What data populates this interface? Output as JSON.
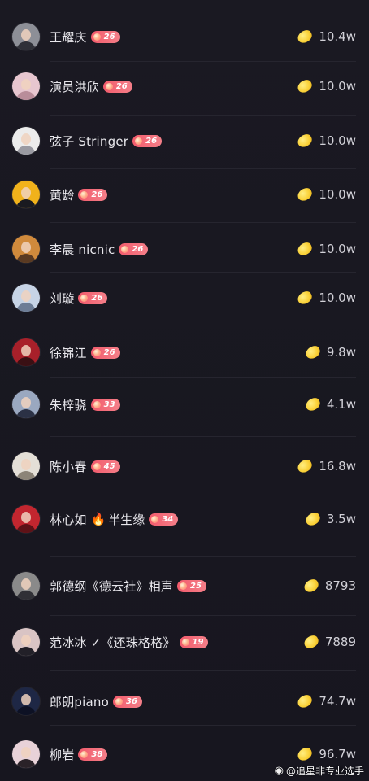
{
  "list": [
    {
      "name": "王耀庆",
      "level": "26",
      "value": "10.4w",
      "avatar_colors": [
        "#8d8f97",
        "#2f3038"
      ]
    },
    {
      "name": "演员洪欣",
      "level": "26",
      "value": "10.0w",
      "avatar_colors": [
        "#e7c6cf",
        "#b98d9a"
      ]
    },
    {
      "name": "弦子 Stringer",
      "level": "26",
      "value": "10.0w",
      "avatar_colors": [
        "#ececec",
        "#9a9aa2"
      ]
    },
    {
      "name": "黄龄",
      "level": "26",
      "value": "10.0w",
      "avatar_colors": [
        "#f1b21b",
        "#1a1a20"
      ]
    },
    {
      "name": "李晨 nicnic",
      "level": "26",
      "value": "10.0w",
      "avatar_colors": [
        "#d08a3c",
        "#5a3a22"
      ]
    },
    {
      "name": "刘璇",
      "level": "26",
      "value": "10.0w",
      "avatar_colors": [
        "#c7d4e6",
        "#6d7d96"
      ]
    },
    {
      "name": "徐锦江",
      "level": "26",
      "value": "9.8w",
      "avatar_colors": [
        "#a8202a",
        "#3a1014"
      ]
    },
    {
      "name": "朱梓骁",
      "level": "33",
      "value": "4.1w",
      "avatar_colors": [
        "#9aa8c0",
        "#2b3145"
      ]
    },
    {
      "name": "陈小春",
      "level": "45",
      "value": "16.8w",
      "avatar_colors": [
        "#e4dfd7",
        "#8c8478"
      ]
    },
    {
      "name": "林心如",
      "tail": "半生缘",
      "fire": "🔥",
      "level": "34",
      "value": "3.5w",
      "avatar_colors": [
        "#c2262f",
        "#5e1217"
      ]
    },
    {
      "name": "郭德纲《德云社》相声",
      "level": "25",
      "value": "8793",
      "avatar_colors": [
        "#8a8a8a",
        "#303036"
      ]
    },
    {
      "name": "范冰冰 ✓《还珠格格》",
      "level": "19",
      "value": "7889",
      "avatar_colors": [
        "#d9c4c4",
        "#222028"
      ]
    },
    {
      "name": "郎朗piano",
      "level": "36",
      "value": "74.7w",
      "avatar_colors": [
        "#1e2745",
        "#0d1124"
      ]
    },
    {
      "name": "柳岩",
      "level": "38",
      "value": "96.7w",
      "avatar_colors": [
        "#e8d2d8",
        "#2a2228"
      ]
    }
  ],
  "watermark": {
    "icon": "weibo-icon",
    "text": "@追星非专业选手"
  },
  "colors": {
    "background": "#17161f",
    "badge": "#f25b6c",
    "bean": "#fad138",
    "text": "#e8e7ec"
  }
}
